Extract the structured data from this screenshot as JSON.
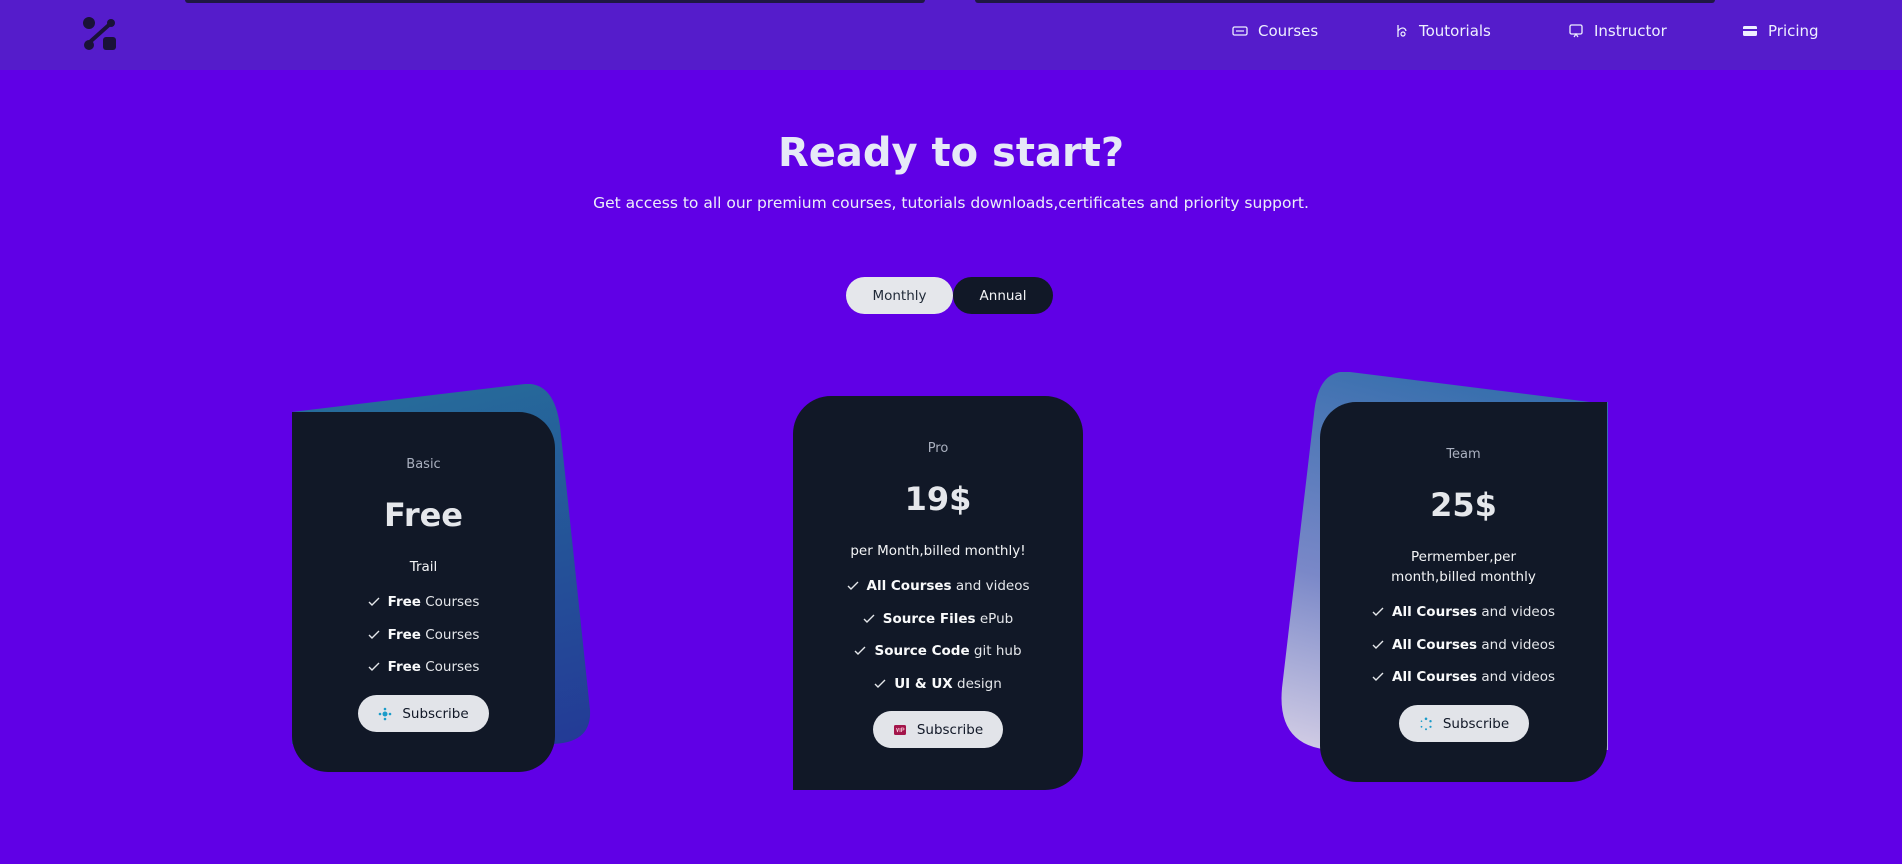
{
  "nav": {
    "items": [
      {
        "label": "Courses",
        "icon": "keyboard-icon"
      },
      {
        "label": "Toutorials",
        "icon": "tutorial-icon"
      },
      {
        "label": "Instructor",
        "icon": "monitor-icon"
      },
      {
        "label": "Pricing",
        "icon": "credit-card-icon"
      }
    ]
  },
  "hero": {
    "title": "Ready to start?",
    "subtitle": "Get access to all our premium courses, tutorials downloads,certificates and priority support."
  },
  "billing_toggle": {
    "monthly": "Monthly",
    "annual": "Annual",
    "selected": "Monthly"
  },
  "plans": [
    {
      "name": "Basic",
      "price": "Free",
      "description": "Trail",
      "features": [
        {
          "bold": "Free",
          "text": "Courses"
        },
        {
          "bold": "Free",
          "text": "Courses"
        },
        {
          "bold": "Free",
          "text": "Courses"
        }
      ],
      "button": "Subscribe"
    },
    {
      "name": "Pro",
      "price": "19$",
      "description": "per Month,billed monthly!",
      "features": [
        {
          "bold": "All Courses",
          "text": "and videos"
        },
        {
          "bold": "Source Files",
          "text": "ePub"
        },
        {
          "bold": "Source Code",
          "text": "git hub"
        },
        {
          "bold": "UI & UX",
          "text": "design"
        }
      ],
      "button": "Subscribe"
    },
    {
      "name": "Team",
      "price": "25$",
      "description": "Permember,per month,billed monthly",
      "features": [
        {
          "bold": "All Courses",
          "text": "and videos"
        },
        {
          "bold": "All Courses",
          "text": "and videos"
        },
        {
          "bold": "All Courses",
          "text": "and videos"
        }
      ],
      "button": "Subscribe"
    }
  ],
  "colors": {
    "background": "#6000e6",
    "header": "#551ccb",
    "card": "#111827",
    "button": "#e2e4e9"
  }
}
